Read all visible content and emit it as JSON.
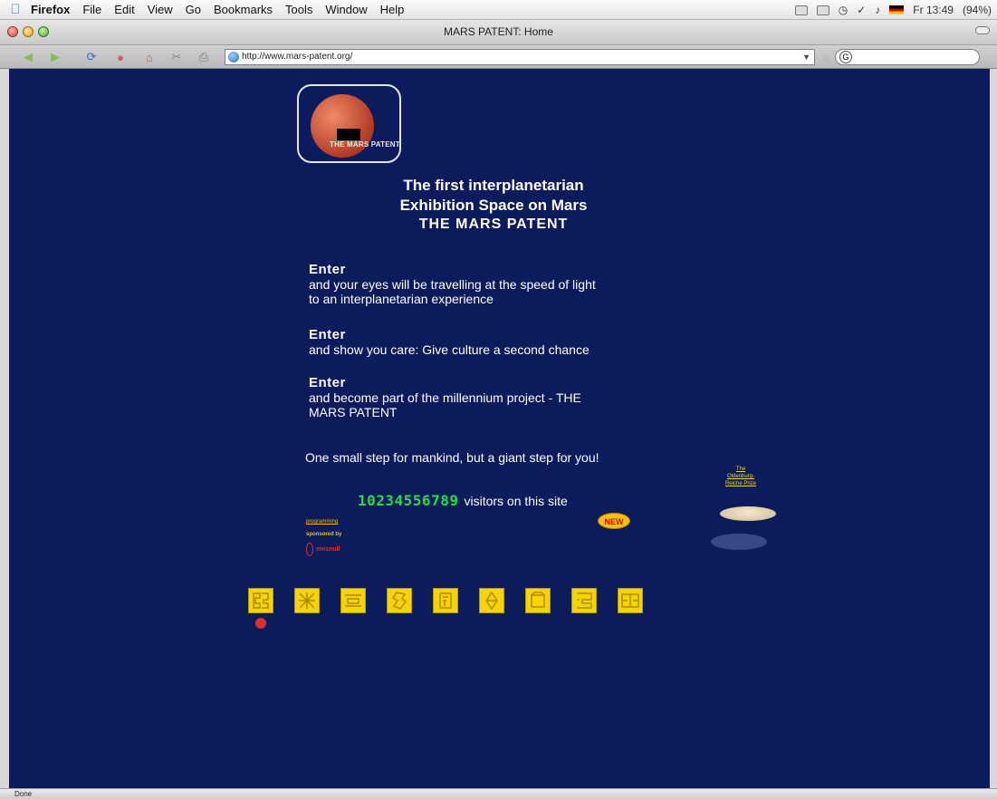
{
  "menubar": {
    "app": "Firefox",
    "items": [
      "File",
      "Edit",
      "View",
      "Go",
      "Bookmarks",
      "Tools",
      "Window",
      "Help"
    ],
    "clock": "Fr 13:49",
    "battery": "(94%)"
  },
  "window": {
    "title": "MARS PATENT: Home"
  },
  "toolbar": {
    "url": "http://www.mars-patent.org/"
  },
  "page": {
    "logo_text": "THE MARS PATENT",
    "headline_line1": "The first interplanetarian",
    "headline_line2": "Exhibition Space on Mars",
    "headline_line3": "THE MARS PATENT",
    "enter_blocks": [
      {
        "title": "Enter",
        "text_line1": "and your eyes will be travelling at the speed of light",
        "text_line2": "to an interplanetarian experience"
      },
      {
        "title": "Enter",
        "text_line1": "and show you care: Give culture a second chance",
        "text_line2": ""
      },
      {
        "title": "Enter",
        "text_line1": "and become part of the millennium project - THE",
        "text_line2": "MARS PATENT"
      }
    ],
    "slogan": "One small step for mankind, but a giant step for you!",
    "counter_digits": "10234556789",
    "counter_label": "visitors on this site",
    "programming_link": "programming",
    "sponsored_by": "sponsored by",
    "sponsor_name": "einsnull",
    "new_badge": "NEW",
    "prize_line1": "The",
    "prize_line2": "Oldenburg-",
    "prize_line3": "Reiche Prize"
  },
  "nav_icons": [
    "icon-1",
    "icon-2",
    "icon-3",
    "icon-4",
    "icon-5",
    "icon-6",
    "icon-7",
    "icon-8",
    "icon-9"
  ],
  "statusbar": {
    "text": "Done"
  },
  "colors": {
    "page_bg": "#0b1b5c",
    "icon_yellow": "#f5d400",
    "counter_green": "#20e040"
  }
}
